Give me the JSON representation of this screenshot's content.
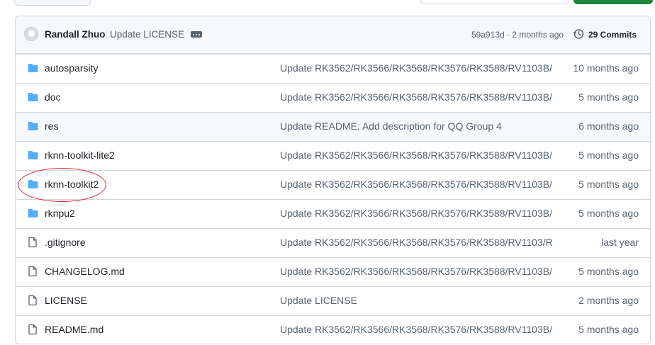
{
  "header": {
    "author": "Randall Zhuo",
    "message": "Update LICENSE",
    "sha_time": "59a913d · 2 months ago",
    "commits_label": "29 Commits"
  },
  "rows": [
    {
      "type": "folder",
      "name": "autosparsity",
      "message": "Update RK3562/RK3566/RK3568/RK3576/RK3588/RV1103B/...",
      "date": "10 months ago"
    },
    {
      "type": "folder",
      "name": "doc",
      "message": "Update RK3562/RK3566/RK3568/RK3576/RK3588/RV1103B/...",
      "date": "5 months ago"
    },
    {
      "type": "folder",
      "name": "res",
      "message": "Update README: Add description for QQ Group 4",
      "date": "6 months ago"
    },
    {
      "type": "folder",
      "name": "rknn-toolkit-lite2",
      "message": "Update RK3562/RK3566/RK3568/RK3576/RK3588/RV1103B/...",
      "date": "5 months ago"
    },
    {
      "type": "folder",
      "name": "rknn-toolkit2",
      "message": "Update RK3562/RK3566/RK3568/RK3576/RK3588/RV1103B/...",
      "date": "5 months ago"
    },
    {
      "type": "folder",
      "name": "rknpu2",
      "message": "Update RK3562/RK3566/RK3568/RK3576/RK3588/RV1103B/...",
      "date": "5 months ago"
    },
    {
      "type": "file",
      "name": ".gitignore",
      "message": "Update RK3562/RK3566/RK3568/RK3576/RK3588/RV1103/R...",
      "date": "last year"
    },
    {
      "type": "file",
      "name": "CHANGELOG.md",
      "message": "Update RK3562/RK3566/RK3568/RK3576/RK3588/RV1103B/...",
      "date": "5 months ago"
    },
    {
      "type": "file",
      "name": "LICENSE",
      "message": "Update LICENSE",
      "date": "2 months ago"
    },
    {
      "type": "file",
      "name": "README.md",
      "message": "Update RK3562/RK3566/RK3568/RK3576/RK3588/RV1103B/...",
      "date": "5 months ago"
    }
  ],
  "colors": {
    "folder_icon": "#54aeff",
    "file_icon": "#59636e",
    "highlight_ring": "#e0262b"
  },
  "icons": {
    "folder": "folder-icon",
    "file": "file-icon",
    "history": "history-icon",
    "ellipsis": "ellipsis-icon"
  }
}
